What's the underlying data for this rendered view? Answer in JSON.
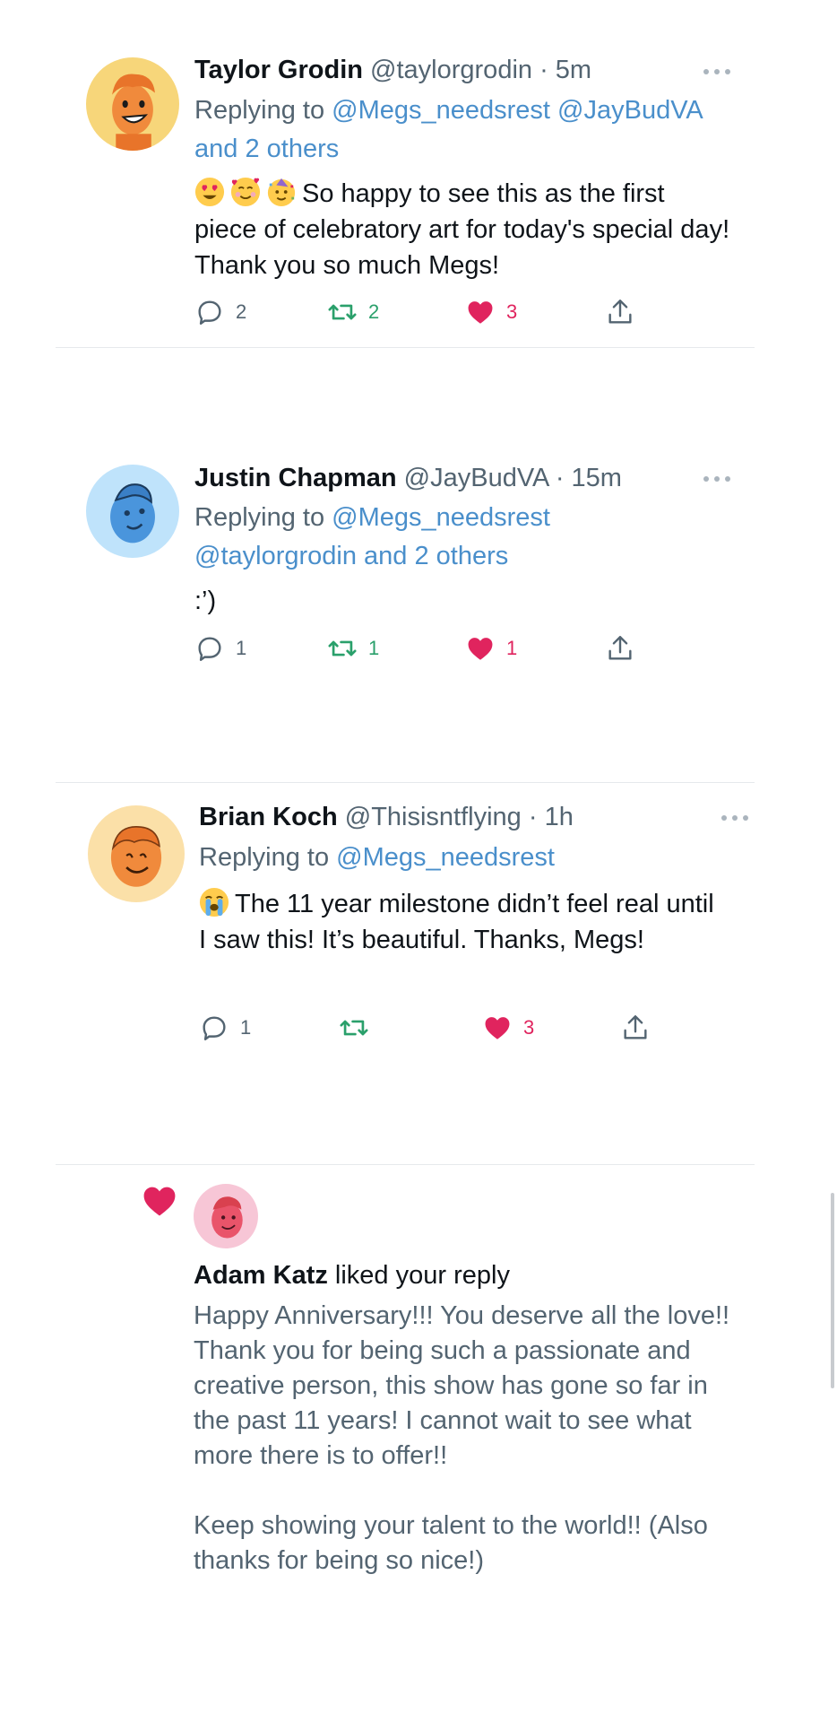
{
  "colors": {
    "mention": "#4a8fcb",
    "retweet": "#2aa06b",
    "like": "#e0245e",
    "secondary_text": "#536471"
  },
  "tweets": [
    {
      "name": "Taylor Grodin",
      "handle": "@taylorgrodin",
      "time": "· 5m",
      "replying_prefix": "Replying to ",
      "mentions_line1": "@Megs_needsrest @JayBudVA",
      "mentions_line2": "and 2 others",
      "text": "So happy to see this as the first piece of celebratory art for today's special day! Thank you so much Megs!",
      "emojis": [
        "heart-eyes-emoji",
        "smiling-hearts-emoji",
        "partying-face-emoji"
      ],
      "replies": "2",
      "retweets": "2",
      "likes": "3"
    },
    {
      "name": "Justin Chapman",
      "handle": "@JayBudVA",
      "time": "· 15m",
      "replying_prefix": "Replying to ",
      "mentions_line1": "@Megs_needsrest",
      "mentions_line2": "@taylorgrodin and 2 others",
      "text": ":’)",
      "replies": "1",
      "retweets": "1",
      "likes": "1"
    },
    {
      "name": "Brian Koch",
      "handle": "@Thisisntflying",
      "time": "· 1h",
      "replying_prefix": "Replying to ",
      "mentions_line1": "@Megs_needsrest",
      "text": "The 11 year milestone didn’t feel real until I saw this! It’s beautiful. Thanks, Megs!",
      "emojis": [
        "loudly-crying-emoji"
      ],
      "replies": "1",
      "retweets": "",
      "likes": "3"
    }
  ],
  "notification": {
    "name": "Adam Katz",
    "action": " liked your reply",
    "text": "Happy Anniversary!!! You deserve all the love!! Thank you for being such a passionate and creative person, this show has gone so far in the past 11 years! I cannot wait to see what more there is to offer!!\n\nKeep showing your talent to the world!! (Also thanks for being so nice!)"
  }
}
